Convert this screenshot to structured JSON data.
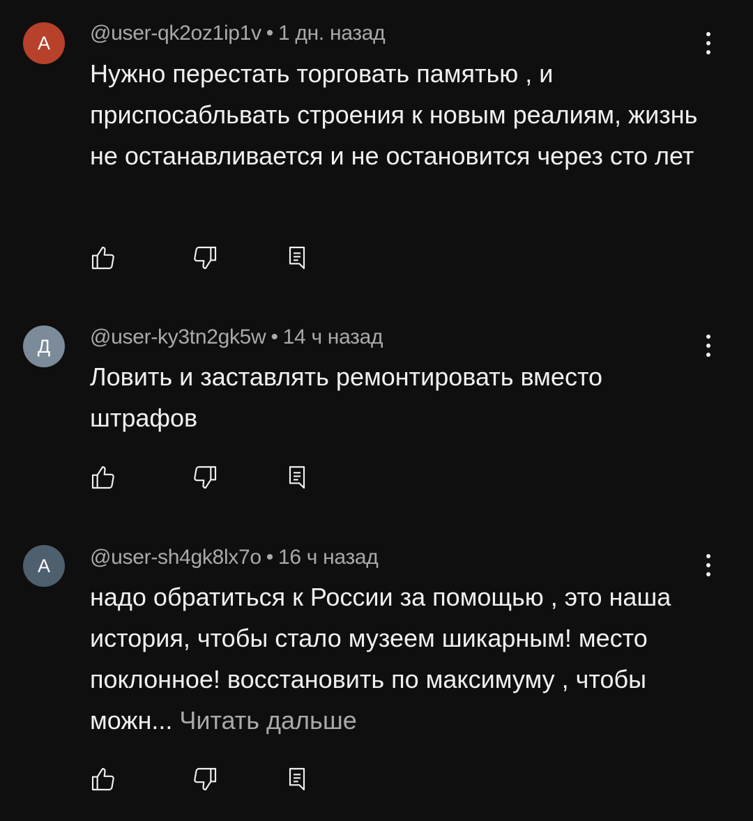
{
  "comments": [
    {
      "avatar_letter": "A",
      "avatar_color": "#b7412b",
      "author": "@user-qk2oz1ip1v",
      "separator": "•",
      "time": "1 дн. назад",
      "text": "Нужно перестать торговать памятью , и приспосабльвать строения к новым реалиям, жизнь не останавливается и не остановится через сто лет",
      "read_more": ""
    },
    {
      "avatar_letter": "Д",
      "avatar_color": "#7b8b99",
      "author": "@user-ky3tn2gk5w",
      "separator": "•",
      "time": "14 ч назад",
      "text": "Ловить и заставлять ремонтировать вместо штрафов",
      "read_more": ""
    },
    {
      "avatar_letter": "A",
      "avatar_color": "#4e5f6e",
      "author": "@user-sh4gk8lx7o",
      "separator": "•",
      "time": "16 ч назад",
      "text": "надо обратиться к России за помощью , это наша история, чтобы стало музеем шикарным! место поклонное! восстановить по максимуму , чтобы можн...",
      "read_more": "Читать дальше"
    }
  ],
  "icons": {
    "like": "thumbs-up-icon",
    "dislike": "thumbs-down-icon",
    "reply": "reply-icon",
    "more": "more-vert-icon"
  },
  "colors": {
    "background": "#0f0f0f",
    "text": "#f1f1f1",
    "secondary_text": "#aaaaaa"
  }
}
